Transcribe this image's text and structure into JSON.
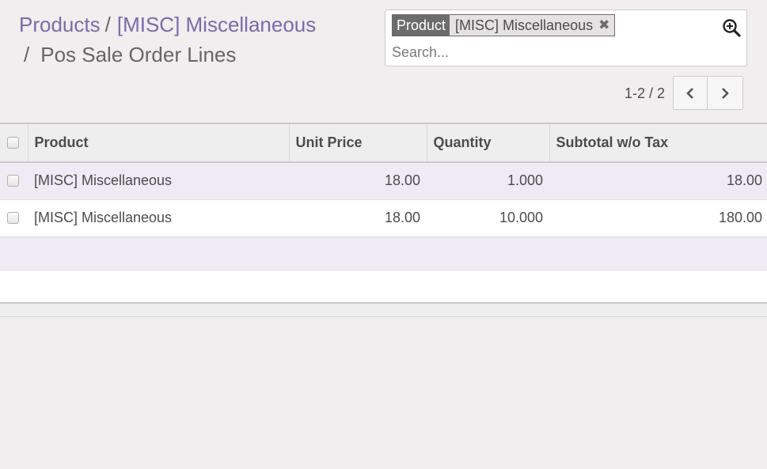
{
  "breadcrumb": {
    "items": [
      {
        "label": "Products"
      },
      {
        "label": "[MISC] Miscellaneous"
      }
    ],
    "separator": "/",
    "current": "Pos Sale Order Lines"
  },
  "search": {
    "facet_label": "Product",
    "facet_value": "[MISC] Miscellaneous",
    "remove_icon": "close-icon",
    "placeholder": "Search...",
    "value": "",
    "toggle_icon": "zoom-in-icon"
  },
  "pager": {
    "value": "1-2 / 2",
    "prev_icon": "chevron-left-icon",
    "next_icon": "chevron-right-icon"
  },
  "table": {
    "columns": [
      "Product",
      "Unit Price",
      "Quantity",
      "Subtotal w/o Tax"
    ],
    "rows": [
      {
        "product": "[MISC] Miscellaneous",
        "unit_price": "18.00",
        "quantity": "1.000",
        "subtotal": "18.00"
      },
      {
        "product": "[MISC] Miscellaneous",
        "unit_price": "18.00",
        "quantity": "10.000",
        "subtotal": "180.00"
      }
    ]
  },
  "colors": {
    "link": "#7c6ba8",
    "facet_label_bg": "#6c6c6c",
    "row_stripe": "#eeebf4",
    "background": "#f0eeee"
  }
}
